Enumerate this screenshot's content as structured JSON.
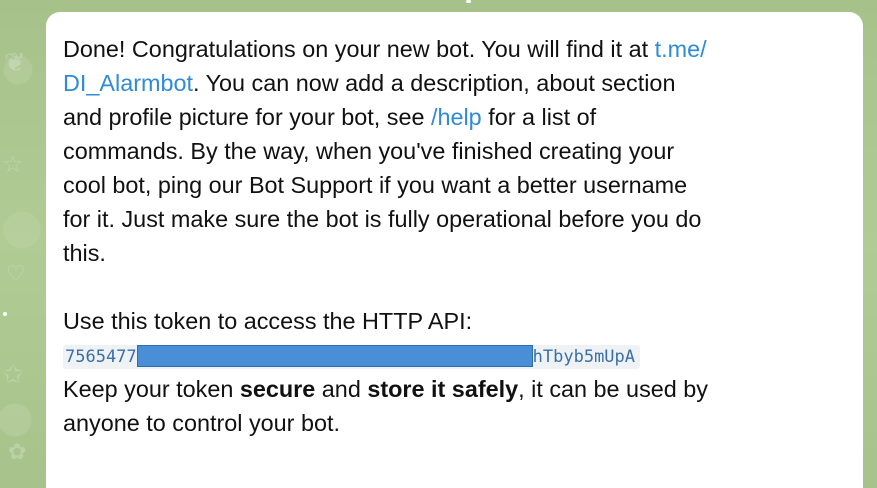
{
  "message": {
    "p1_line1_text": "Done! Congratulations on your new bot. You will find it at ",
    "p1_line1_link": "t.me/",
    "p1_line2_link": "DI_Alarmbot",
    "p1_line2_text": ". You can now add a description, about section",
    "p1_line3_text": "and profile picture for your bot, see ",
    "p1_line3_link": "/help",
    "p1_line3_tail": " for a list of",
    "p1_line4": "commands. By the way, when you've finished creating your",
    "p1_line5": "cool bot, ping our Bot Support if you want a better username",
    "p1_line6": "for it. Just make sure the bot is fully operational before you do",
    "p1_line7": "this.",
    "token_intro": "Use this token to access the HTTP API:",
    "token_prefix": "7565477",
    "token_suffix": "hTbyb5mUpA",
    "p3_line1_a": "Keep your token ",
    "p3_line1_b": "secure",
    "p3_line1_c": " and ",
    "p3_line1_d": "store it safely",
    "p3_line1_e": ", it can be used by",
    "p3_line2": "anyone to control your bot."
  },
  "colors": {
    "chat_background": "#a9c48f",
    "bubble": "#ffffff",
    "link": "#2f8ad9",
    "redaction": "#4a8fd6"
  }
}
